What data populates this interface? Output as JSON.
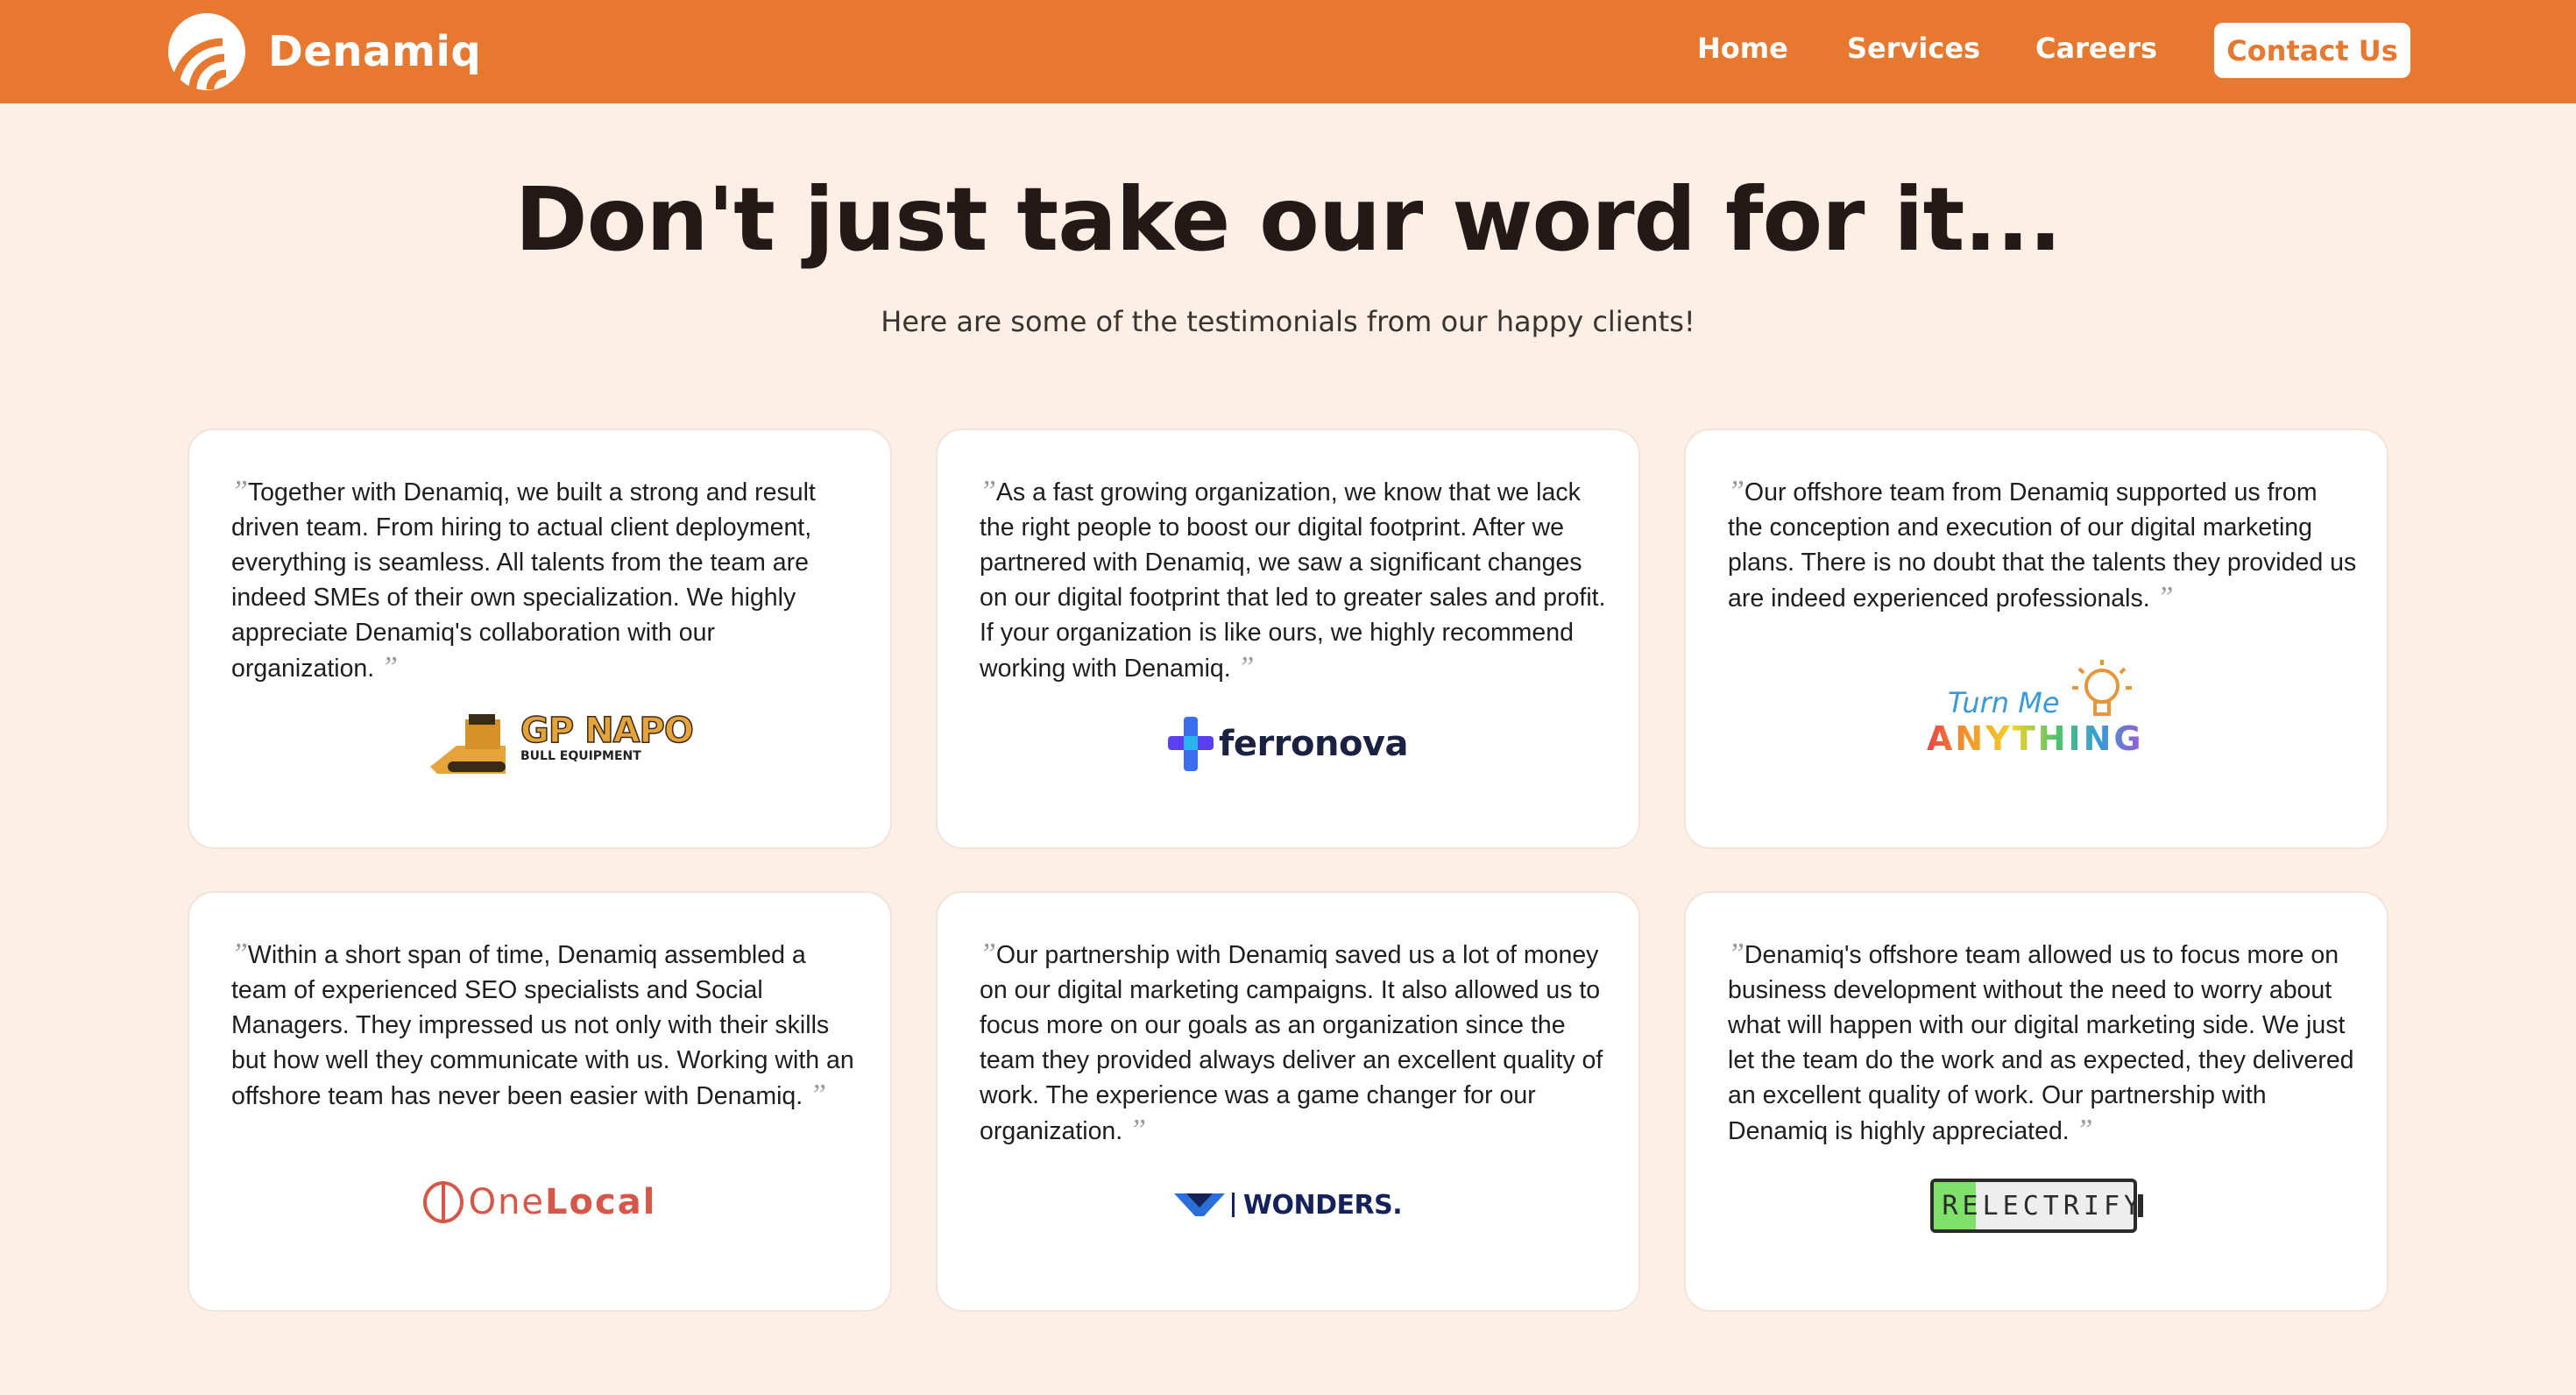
{
  "nav": {
    "brand": "Denamiq",
    "links": [
      "Home",
      "Services",
      "Careers"
    ],
    "cta": "Contact Us"
  },
  "hero": {
    "title": "Don't just take our word for it...",
    "subtitle": "Here are some of the testimonials from our happy clients!"
  },
  "testimonials": [
    {
      "quote": "Together with Denamiq, we built a strong and result driven team. From hiring to actual client deployment, everything is seamless. All talents from the team are indeed SMEs of their own specialization. We highly appreciate Denamiq's collaboration with our organization.",
      "logo_name": "GP NAPO",
      "logo_sub": "BULL EQUIPMENT"
    },
    {
      "quote": "As a fast growing organization, we know that we lack the right people to boost our digital footprint. After we partnered with Denamiq, we saw a significant changes on our digital footprint that led to greater sales and profit. If your organization is like ours, we highly recommend working with Denamiq.",
      "logo_name": "ferronova"
    },
    {
      "quote": "Our offshore team from Denamiq supported us from the conception and execution of our digital marketing plans. There is no doubt that the talents they provided us are indeed experienced professionals.",
      "logo_name": "Turn Me",
      "logo_sub": "ANYTHING"
    },
    {
      "quote": "Within a short span of time, Denamiq assembled a team of experienced SEO specialists and Social Managers. They impressed us not only with their skills but how well they communicate with us. Working with an offshore team has never been easier with Denamiq.",
      "logo_name": "One",
      "logo_sub": "Local"
    },
    {
      "quote": "Our partnership with Denamiq saved us a lot of money on our digital marketing campaigns. It also allowed us to focus more on our goals as an organization since the team they provided always deliver an excellent quality of work. The experience was a game changer for our organization.",
      "logo_name": "WONDERS."
    },
    {
      "quote": "Denamiq's offshore team allowed us to focus more on business development without the need to worry about what will happen with our digital marketing side. We just let the team do the work and as expected, they delivered an excellent quality of work. Our partnership with Denamiq is highly appreciated.",
      "logo_name": "RE",
      "logo_sub": "LECTRIFY"
    }
  ],
  "quote_mark": "”",
  "colors": {
    "brand": "#e67830",
    "background": "#fbefe6"
  }
}
